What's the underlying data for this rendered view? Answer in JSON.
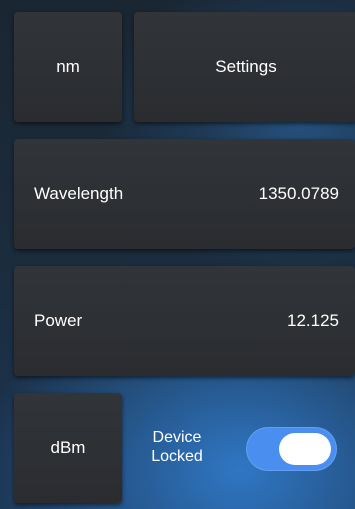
{
  "top": {
    "unit_label": "nm",
    "settings_label": "Settings"
  },
  "wavelength": {
    "label": "Wavelength",
    "value": "1350.0789"
  },
  "power": {
    "label": "Power",
    "value": "12.125"
  },
  "bottom": {
    "unit_label": "dBm",
    "lock_label_line1": "Device",
    "lock_label_line2": "Locked",
    "locked": true
  },
  "colors": {
    "toggle_on": "#4a8ff0",
    "tile": "#2f3236",
    "text": "#ffffff"
  }
}
